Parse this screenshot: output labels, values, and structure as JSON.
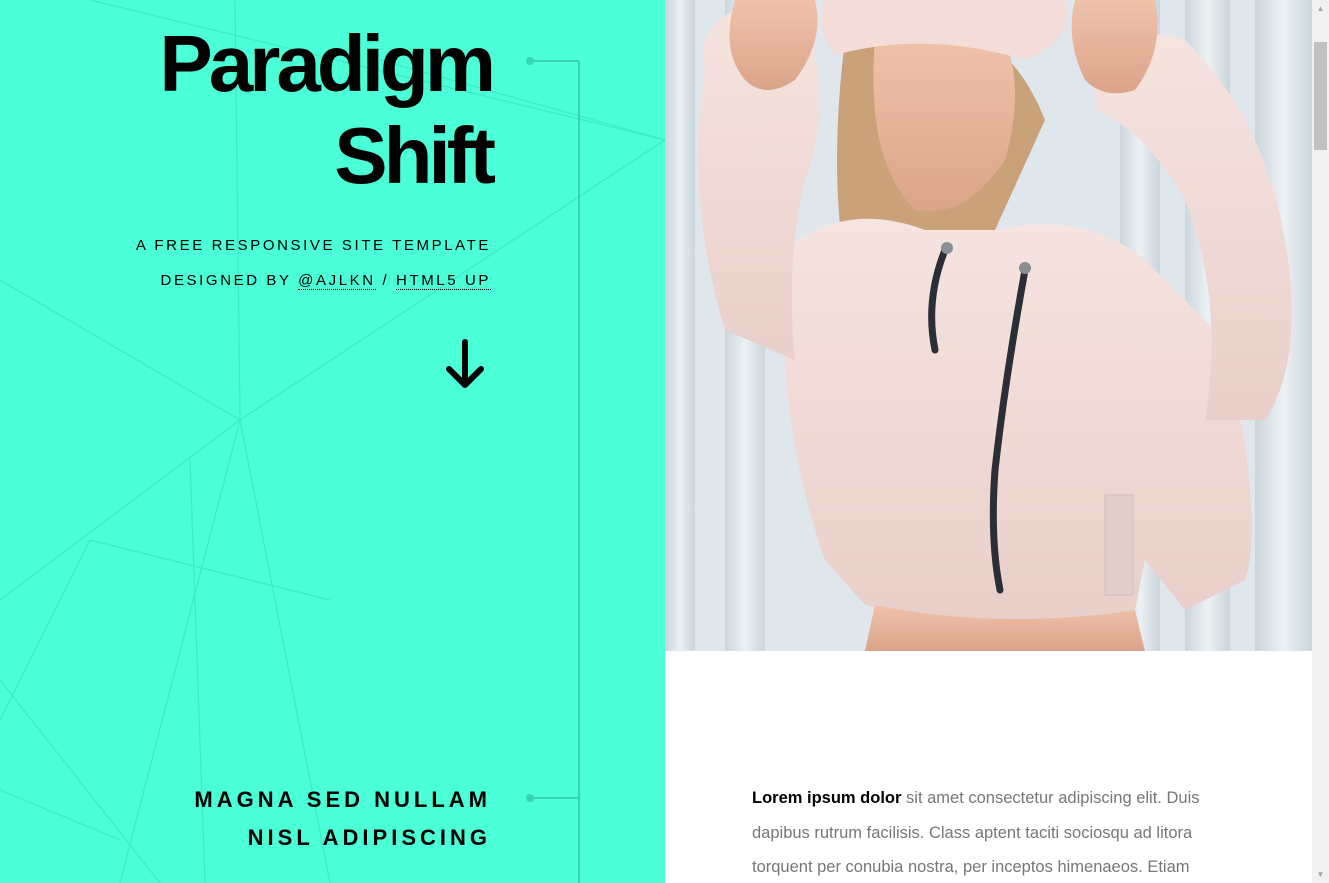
{
  "header": {
    "title_line1": "Paradigm",
    "title_line2": "Shift",
    "tagline": "A free responsive site template",
    "designed_by_prefix": "Designed by",
    "author_link": "@ajlkn",
    "separator": "/",
    "source_link": "HTML5 UP"
  },
  "scroll_icon": "arrow-down-icon",
  "section": {
    "heading_line1": "Magna sed nullam",
    "heading_line2": "nisl adipiscing",
    "body_bold": "Lorem ipsum dolor",
    "body_text": " sit amet consectetur adipiscing elit. Duis dapibus rutrum facilisis. Class aptent taciti sociosqu ad litora torquent per conubia nostra, per inceptos himenaeos. Etiam"
  },
  "colors": {
    "accent": "#4bffd6",
    "text_dark": "#000000",
    "body_text": "#777777"
  }
}
